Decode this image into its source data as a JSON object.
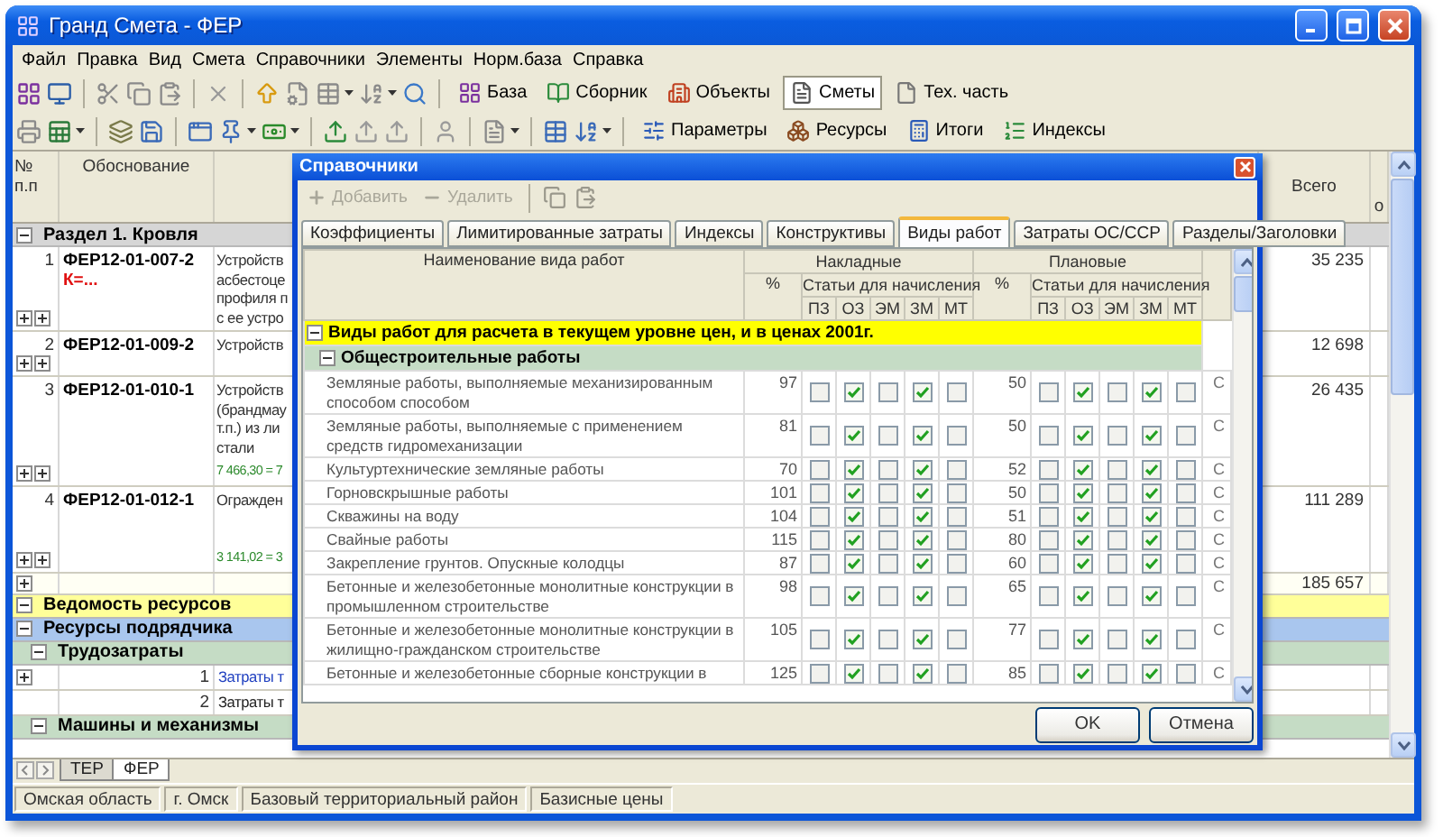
{
  "window": {
    "title": "Гранд Смета - ФЕР"
  },
  "menu": [
    "Файл",
    "Правка",
    "Вид",
    "Смета",
    "Справочники",
    "Элементы",
    "Норм.база",
    "Справка"
  ],
  "toolbar_1": [
    {
      "label": "База",
      "selected": false
    },
    {
      "label": "Сборник",
      "selected": false
    },
    {
      "label": "Объекты",
      "selected": false
    },
    {
      "label": "Сметы",
      "selected": true
    },
    {
      "label": "Тех. часть",
      "selected": false
    }
  ],
  "toolbar_2": [
    "Параметры",
    "Ресурсы",
    "Итоги",
    "Индексы"
  ],
  "estimate": {
    "columns": [
      "№ п.п",
      "Обоснование",
      "Всего",
      "о"
    ],
    "rows": [
      {
        "kind": "section",
        "label": "Раздел 1. Кровля",
        "expanded": true
      },
      {
        "kind": "item",
        "number": "1",
        "code": "ФЕР12-01-007-2",
        "note": "К=...",
        "description": [
          "Устройств",
          "асбестоце",
          "профиля п",
          "с ее устро"
        ],
        "total": "35 235"
      },
      {
        "kind": "item",
        "number": "2",
        "code": "ФЕР12-01-009-2",
        "description": [
          "Устройств"
        ],
        "total": "12 698"
      },
      {
        "kind": "item",
        "number": "3",
        "code": "ФЕР12-01-010-1",
        "description": [
          "Устройств",
          "(брандмау",
          "т.п.) из ли",
          "стали"
        ],
        "sum": "7 466,30 = 7",
        "total": "26 435"
      },
      {
        "kind": "item",
        "number": "4",
        "code": "ФЕР12-01-012-1",
        "description": [
          "Огражден"
        ],
        "sum": "3 141,02 = 3",
        "total": "111 289"
      },
      {
        "kind": "subtotal",
        "total": "185 657"
      },
      {
        "kind": "resources",
        "label": "Ведомость ресурсов",
        "expanded": true
      },
      {
        "kind": "contractor",
        "label": "Ресурсы подрядчика",
        "expanded": true
      },
      {
        "kind": "category",
        "label": "Трудозатраты",
        "expanded": true
      },
      {
        "kind": "resource",
        "number": "1",
        "description": "Затраты т",
        "link": true
      },
      {
        "kind": "resource",
        "number": "2",
        "description": "Затраты т",
        "link": false
      },
      {
        "kind": "category",
        "label": "Машины и механизмы",
        "expanded": true
      }
    ]
  },
  "sheet_tabs": [
    {
      "label": "ТЕР",
      "selected": false
    },
    {
      "label": "ФЕР",
      "selected": true
    }
  ],
  "status_bar": [
    "Омская область",
    "г. Омск",
    "Базовый территориальный район",
    "Базисные цены"
  ],
  "dialog": {
    "title": "Справочники",
    "toolbar": [
      {
        "label": "Добавить",
        "disabled": true
      },
      {
        "label": "Удалить",
        "disabled": true
      }
    ],
    "tabs": [
      {
        "label": "Коэффициенты",
        "selected": false
      },
      {
        "label": "Лимитированные затраты",
        "selected": false
      },
      {
        "label": "Индексы",
        "selected": false
      },
      {
        "label": "Конструктивы",
        "selected": false
      },
      {
        "label": "Виды работ",
        "selected": true
      },
      {
        "label": "Затраты ОС/ССР",
        "selected": false
      },
      {
        "label": "Разделы/Заголовки",
        "selected": false
      }
    ],
    "table": {
      "name_header": "Наименование вида работ",
      "overhead_header": {
        "title": "Накладные",
        "percent": "%",
        "group": "Статьи для начисления",
        "items": [
          "ПЗ",
          "ОЗ",
          "ЭМ",
          "ЗМ",
          "МТ"
        ]
      },
      "planned_header": {
        "title": "Плановые",
        "percent": "%",
        "group": "Статьи для начисления",
        "items": [
          "ПЗ",
          "ОЗ",
          "ЭМ",
          "ЗМ",
          "МТ"
        ]
      },
      "rows": [
        {
          "kind": "group",
          "label": "Виды работ для расчета в текущем уровне цен, и в ценах 2001г.",
          "expanded": true
        },
        {
          "kind": "subgroup",
          "label": "Общестроительные работы",
          "expanded": true
        },
        {
          "kind": "work",
          "name": "Земляные работы, выполняемые механизированным способом способом",
          "overhead": "97",
          "overhead_items": [
            false,
            true,
            false,
            true,
            false
          ],
          "planned": "50",
          "planned_items": [
            false,
            true,
            false,
            true,
            false
          ],
          "column_13": "С"
        },
        {
          "kind": "work",
          "name": "Земляные работы, выполняемые с применением средств гидромеханизации",
          "overhead": "81",
          "overhead_items": [
            false,
            true,
            false,
            true,
            false
          ],
          "planned": "50",
          "planned_items": [
            false,
            true,
            false,
            true,
            false
          ],
          "column_13": "С"
        },
        {
          "kind": "work",
          "name": "Культуртехнические земляные работы",
          "overhead": "70",
          "overhead_items": [
            false,
            true,
            false,
            true,
            false
          ],
          "planned": "52",
          "planned_items": [
            false,
            true,
            false,
            true,
            false
          ],
          "column_13": "С"
        },
        {
          "kind": "work",
          "name": "Горновскрышные работы",
          "overhead": "101",
          "overhead_items": [
            false,
            true,
            false,
            true,
            false
          ],
          "planned": "50",
          "planned_items": [
            false,
            true,
            false,
            true,
            false
          ],
          "column_13": "С"
        },
        {
          "kind": "work",
          "name": "Скважины на воду",
          "overhead": "104",
          "overhead_items": [
            false,
            true,
            false,
            true,
            false
          ],
          "planned": "51",
          "planned_items": [
            false,
            true,
            false,
            true,
            false
          ],
          "column_13": "С"
        },
        {
          "kind": "work",
          "name": "Свайные работы",
          "overhead": "115",
          "overhead_items": [
            false,
            true,
            false,
            true,
            false
          ],
          "planned": "80",
          "planned_items": [
            false,
            true,
            false,
            true,
            false
          ],
          "column_13": "С"
        },
        {
          "kind": "work",
          "name": "Закрепление грунтов. Опускные колодцы",
          "overhead": "87",
          "overhead_items": [
            false,
            true,
            false,
            true,
            false
          ],
          "planned": "60",
          "planned_items": [
            false,
            true,
            false,
            true,
            false
          ],
          "column_13": "С"
        },
        {
          "kind": "work",
          "name": "Бетонные и железобетонные монолитные конструкции в промышленном строительстве",
          "overhead": "98",
          "overhead_items": [
            false,
            true,
            false,
            true,
            false
          ],
          "planned": "65",
          "planned_items": [
            false,
            true,
            false,
            true,
            false
          ],
          "column_13": "С"
        },
        {
          "kind": "work",
          "name": "Бетонные и железобетонные монолитные конструкции в жилищно-гражданском строительстве",
          "overhead": "105",
          "overhead_items": [
            false,
            true,
            false,
            true,
            false
          ],
          "planned": "77",
          "planned_items": [
            false,
            true,
            false,
            true,
            false
          ],
          "column_13": "С"
        },
        {
          "kind": "work",
          "name": "Бетонные и железобетонные сборные конструкции в",
          "overhead": "125",
          "overhead_items": [
            false,
            true,
            false,
            true,
            false
          ],
          "planned": "85",
          "planned_items": [
            false,
            true,
            false,
            true,
            false
          ],
          "column_13": "С"
        }
      ]
    },
    "buttons": [
      "OK",
      "Отмена"
    ]
  }
}
